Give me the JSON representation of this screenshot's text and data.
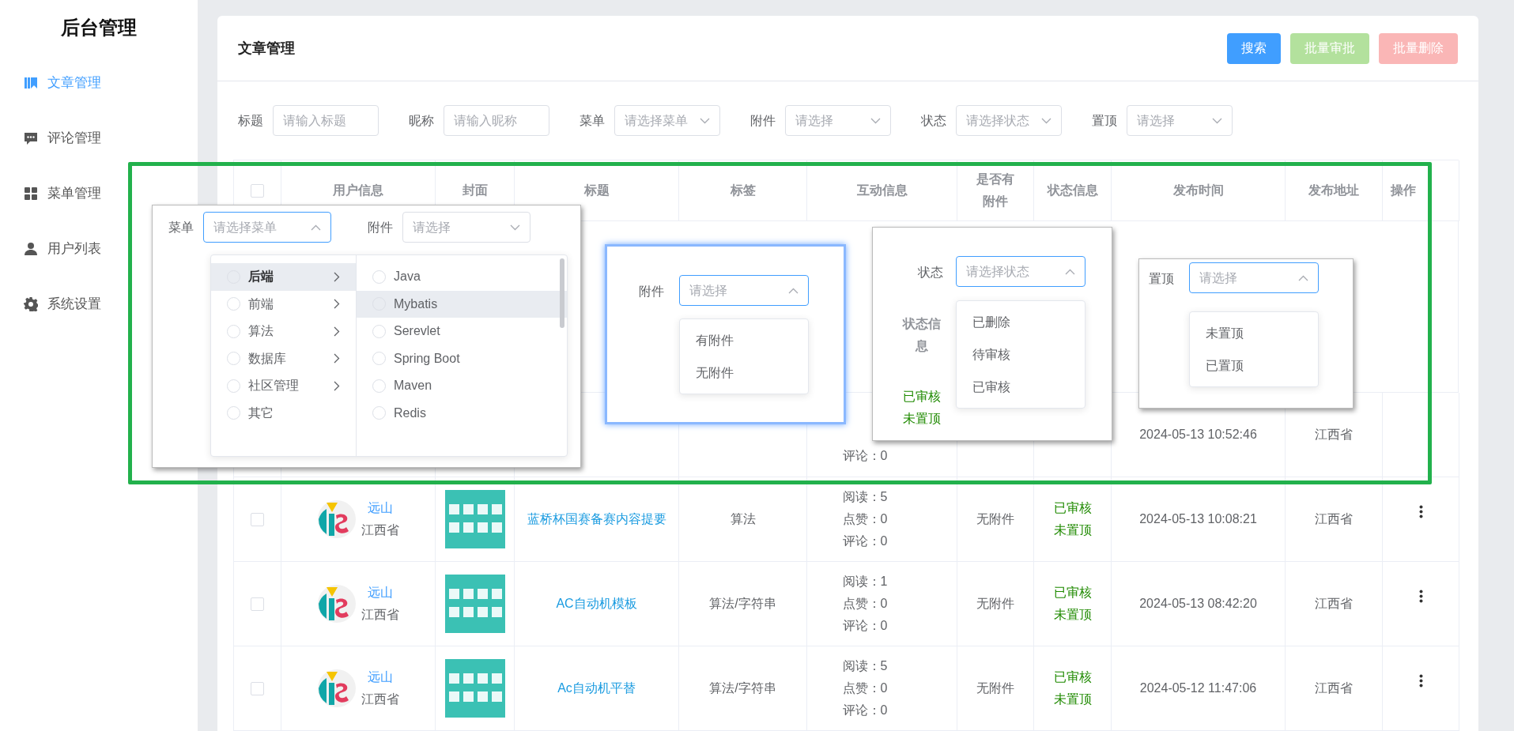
{
  "sidebar": {
    "title": "后台管理",
    "items": [
      {
        "label": "文章管理",
        "selected": true
      },
      {
        "label": "评论管理",
        "selected": false
      },
      {
        "label": "菜单管理",
        "selected": false
      },
      {
        "label": "用户列表",
        "selected": false
      },
      {
        "label": "系统设置",
        "selected": false
      }
    ]
  },
  "page": {
    "title": "文章管理",
    "buttons": [
      {
        "label": "搜索",
        "kind": "primary",
        "disabled": false
      },
      {
        "label": "批量审批",
        "kind": "success",
        "disabled": true
      },
      {
        "label": "批量删除",
        "kind": "danger",
        "disabled": true
      }
    ]
  },
  "filters": [
    {
      "label": "标题",
      "placeholder": "请输入标题",
      "kind": "input"
    },
    {
      "label": "昵称",
      "placeholder": "请输入昵称",
      "kind": "input"
    },
    {
      "label": "菜单",
      "placeholder": "请选择菜单",
      "kind": "select"
    },
    {
      "label": "附件",
      "placeholder": "请选择",
      "kind": "select"
    },
    {
      "label": "状态",
      "placeholder": "请选择状态",
      "kind": "select"
    },
    {
      "label": "置顶",
      "placeholder": "请选择",
      "kind": "select"
    }
  ],
  "table": {
    "columns": [
      "用户信息",
      "封面",
      "标题",
      "标签",
      "互动信息",
      "是否有附件",
      "状态信息",
      "发布时间",
      "发布地址",
      "操作"
    ],
    "header_checked": false,
    "partial_rows": [
      {
        "time": "2024-05-13 10:52:46",
        "address": "江西省",
        "stats": [
          "评论：0"
        ]
      }
    ],
    "rows": [
      {
        "checked": false,
        "user": {
          "name": "远山",
          "region": "江西省"
        },
        "cover": {
          "kind": "picture"
        },
        "title": "蓝桥杯国赛备赛内容提要",
        "tag": "算法",
        "stats": [
          "阅读：5",
          "点赞：0",
          "评论：0"
        ],
        "attachment": "无附件",
        "status": [
          "已审核",
          "未置顶"
        ],
        "time": "2024-05-13 10:08:21",
        "address": "江西省"
      },
      {
        "checked": false,
        "user": {
          "name": "远山",
          "region": "江西省"
        },
        "cover": {
          "kind": "picture"
        },
        "title": "AC自动机模板",
        "tag": "算法/字符串",
        "stats": [
          "阅读：1",
          "点赞：0",
          "评论：0"
        ],
        "attachment": "无附件",
        "status": [
          "已审核",
          "未置顶"
        ],
        "time": "2024-05-13 08:42:20",
        "address": "江西省"
      },
      {
        "checked": false,
        "user": {
          "name": "远山",
          "region": "江西省"
        },
        "cover": {
          "kind": "picture"
        },
        "title": "Ac自动机平替",
        "tag": "算法/字符串",
        "stats": [
          "阅读：5",
          "点赞：0",
          "评论：0"
        ],
        "attachment": "无附件",
        "status": [
          "已审核",
          "未置顶"
        ],
        "time": "2024-05-12 11:47:06",
        "address": "江西省"
      }
    ]
  },
  "overlays": [
    {
      "kind": "cascader",
      "fields": [
        {
          "label": "菜单",
          "placeholder": "请选择菜单",
          "open": true
        },
        {
          "label": "附件",
          "placeholder": "请选择",
          "open": false
        }
      ],
      "columns": [
        [
          {
            "label": "后端",
            "has_children": true,
            "highlighted": true
          },
          {
            "label": "前端",
            "has_children": true,
            "highlighted": false
          },
          {
            "label": "算法",
            "has_children": true,
            "highlighted": false
          },
          {
            "label": "数据库",
            "has_children": true,
            "highlighted": false
          },
          {
            "label": "社区管理",
            "has_children": true,
            "highlighted": false
          },
          {
            "label": "其它",
            "has_children": false,
            "highlighted": false
          }
        ],
        [
          {
            "label": "Java",
            "has_children": false,
            "highlighted": false
          },
          {
            "label": "Mybatis",
            "has_children": false,
            "highlighted": true
          },
          {
            "label": "Serevlet",
            "has_children": false,
            "highlighted": false
          },
          {
            "label": "Spring Boot",
            "has_children": false,
            "highlighted": false
          },
          {
            "label": "Maven",
            "has_children": false,
            "highlighted": false
          },
          {
            "label": "Redis",
            "has_children": false,
            "highlighted": false
          }
        ]
      ]
    },
    {
      "kind": "select",
      "label": "附件",
      "placeholder": "请选择",
      "open": true,
      "options": [
        "有附件",
        "无附件"
      ]
    },
    {
      "kind": "select",
      "label": "状态",
      "placeholder": "请选择状态",
      "open": true,
      "options": [
        "已删除",
        "待审核",
        "已审核"
      ],
      "column_header": "状态信息",
      "cell": [
        "已审核",
        "未置顶"
      ]
    },
    {
      "kind": "select",
      "label": "置顶",
      "placeholder": "请选择",
      "open": true,
      "options": [
        "未置顶",
        "已置顶"
      ]
    }
  ]
}
